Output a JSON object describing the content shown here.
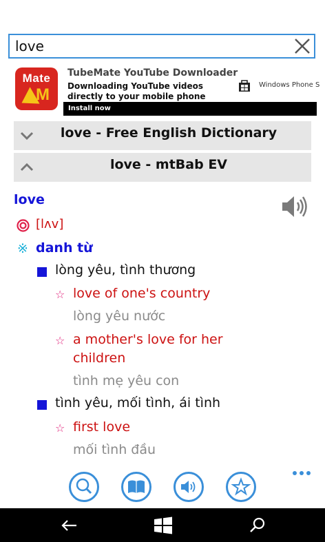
{
  "search": {
    "value": "love"
  },
  "ad": {
    "logo_text": "Mate",
    "logo_letter": "M",
    "title": "TubeMate YouTube Downloader",
    "line1": "Downloading YouTube videos",
    "line2": "directly to your mobile phone",
    "install_label": "Install now",
    "store_label": "Windows Phone S"
  },
  "dictionaries": [
    {
      "title": "love - Free English Dictionary",
      "state": "collapsed"
    },
    {
      "title": "love - mtBab EV",
      "state": "expanded"
    }
  ],
  "entry": {
    "headword": "love",
    "pronunciation": "[lʌv]",
    "pos_marker": "※",
    "part_of_speech": "danh từ",
    "senses": [
      {
        "meaning": "lòng yêu, tình thương",
        "examples": [
          {
            "phrase": "love of one's country",
            "translation": "lòng yêu nước"
          },
          {
            "phrase_line1": "a mother's love for her",
            "phrase_line2": "children",
            "translation": "tình mẹ yêu con"
          }
        ]
      },
      {
        "meaning": "tình yêu, mối tình, ái tình",
        "examples": [
          {
            "phrase": "first love",
            "translation": "mối tình đầu"
          }
        ]
      }
    ]
  },
  "star_glyph": "☆",
  "colors": {
    "accent": "#3a8fd9",
    "headword": "#1515d8",
    "example": "#cc1111",
    "star": "#e0207a",
    "translation": "#8a8a8a",
    "header_bg": "#e6e6e6"
  },
  "icons": {
    "toolbar": [
      "search-icon",
      "book-icon",
      "speaker-icon",
      "star-icon"
    ],
    "nav": [
      "back-icon",
      "windows-icon",
      "search-icon"
    ]
  }
}
